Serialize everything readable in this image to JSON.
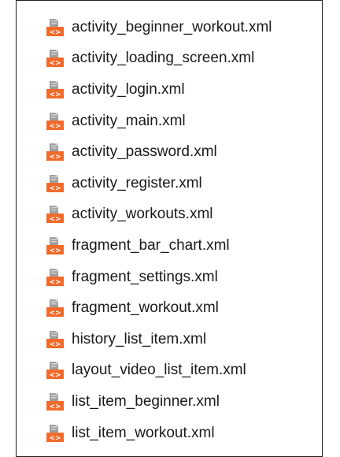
{
  "files": [
    {
      "name": "activity_beginner_workout.xml"
    },
    {
      "name": "activity_loading_screen.xml"
    },
    {
      "name": "activity_login.xml"
    },
    {
      "name": "activity_main.xml"
    },
    {
      "name": "activity_password.xml"
    },
    {
      "name": "activity_register.xml"
    },
    {
      "name": "activity_workouts.xml"
    },
    {
      "name": "fragment_bar_chart.xml"
    },
    {
      "name": "fragment_settings.xml"
    },
    {
      "name": "fragment_workout.xml"
    },
    {
      "name": "history_list_item.xml"
    },
    {
      "name": "layout_video_list_item.xml"
    },
    {
      "name": "list_item_beginner.xml"
    },
    {
      "name": "list_item_workout.xml"
    }
  ],
  "icon": {
    "name": "xml-layout-file-icon",
    "glyph": "<>",
    "colors": {
      "doc": "#9e9e9e",
      "doc_fold": "#d6d6d6",
      "badge": "#f26a2a",
      "badge_text": "#ffffff"
    }
  }
}
